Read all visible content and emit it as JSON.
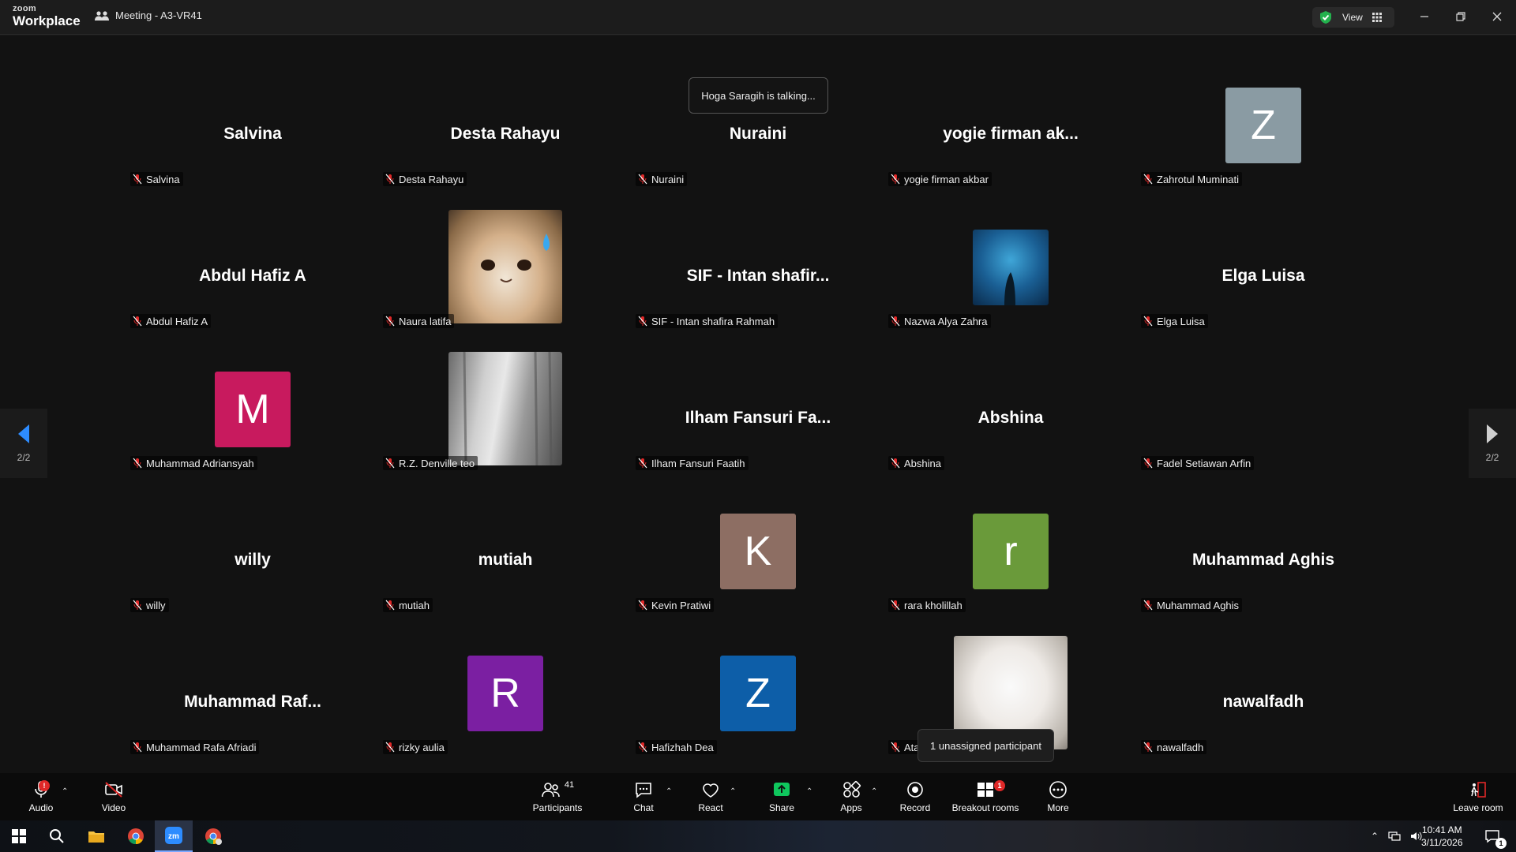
{
  "app": {
    "brand_small": "zoom",
    "brand_big": "Workplace",
    "meeting_title": "Meeting - A3-VR41",
    "view_label": "View"
  },
  "talking_banner": "Hoga Saragih is talking...",
  "pages": {
    "left": "2/2",
    "right": "2/2"
  },
  "participants": [
    {
      "display": "Salvina",
      "label": "Salvina"
    },
    {
      "display": "Desta Rahayu",
      "label": "Desta Rahayu"
    },
    {
      "display": "Nuraini",
      "label": "Nuraini"
    },
    {
      "display": "yogie firman ak...",
      "label": "yogie firman akbar"
    },
    {
      "display": "Z",
      "label": "Zahrotul Muminati",
      "avatar_color": "#8a9ba3"
    },
    {
      "display": "Abdul Hafiz A",
      "label": "Abdul Hafiz A"
    },
    {
      "display": "",
      "label": "Naura latifa",
      "photo": "cat"
    },
    {
      "display": "SIF - Intan shafir...",
      "label": "SIF - Intan shafira Rahmah"
    },
    {
      "display": "",
      "label": "Nazwa Alya Zahra",
      "photo": "ocean"
    },
    {
      "display": "Elga Luisa",
      "label": "Elga Luisa"
    },
    {
      "display": "M",
      "label": "Muhammad Adriansyah",
      "avatar_color": "#c81a5e"
    },
    {
      "display": "",
      "label": "R.Z. Denville teo",
      "photo": "forest"
    },
    {
      "display": "Ilham Fansuri Fa...",
      "label": "Ilham Fansuri Faatih"
    },
    {
      "display": "Abshina",
      "label": "Abshina"
    },
    {
      "display": "",
      "label": "Fadel Setiawan Arfin"
    },
    {
      "display": "willy",
      "label": "willy"
    },
    {
      "display": "mutiah",
      "label": "mutiah"
    },
    {
      "display": "K",
      "label": "Kevin Pratiwi",
      "avatar_color": "#8d6e63"
    },
    {
      "display": "r",
      "label": "rara kholillah",
      "avatar_color": "#6a9a3a"
    },
    {
      "display": "Muhammad Aghis",
      "label": "Muhammad Aghis"
    },
    {
      "display": "Muhammad  Raf...",
      "label": "Muhammad Rafa Afriadi"
    },
    {
      "display": "R",
      "label": "rizky aulia",
      "avatar_color": "#7b1fa2"
    },
    {
      "display": "Z",
      "label": "Hafizhah Dea",
      "avatar_color": "#0d5ea8"
    },
    {
      "display": "",
      "label": "Ata",
      "photo": "rabbit"
    },
    {
      "display": "nawalfadh",
      "label": "nawalfadh"
    }
  ],
  "tooltip": "1 unassigned participant",
  "toolbar": {
    "audio": "Audio",
    "video": "Video",
    "participants": "Participants",
    "participants_count": "41",
    "chat": "Chat",
    "react": "React",
    "share": "Share",
    "apps": "Apps",
    "record": "Record",
    "breakout": "Breakout rooms",
    "breakout_badge": "1",
    "more": "More",
    "leave": "Leave room",
    "audio_badge": "!"
  },
  "taskbar": {
    "time": "10:41 AM",
    "date": "3/11/2026",
    "notif_count": "1"
  },
  "colors": {
    "share_green": "#0fc75d",
    "danger_red": "#e02828",
    "nav_blue": "#2d8cff"
  }
}
